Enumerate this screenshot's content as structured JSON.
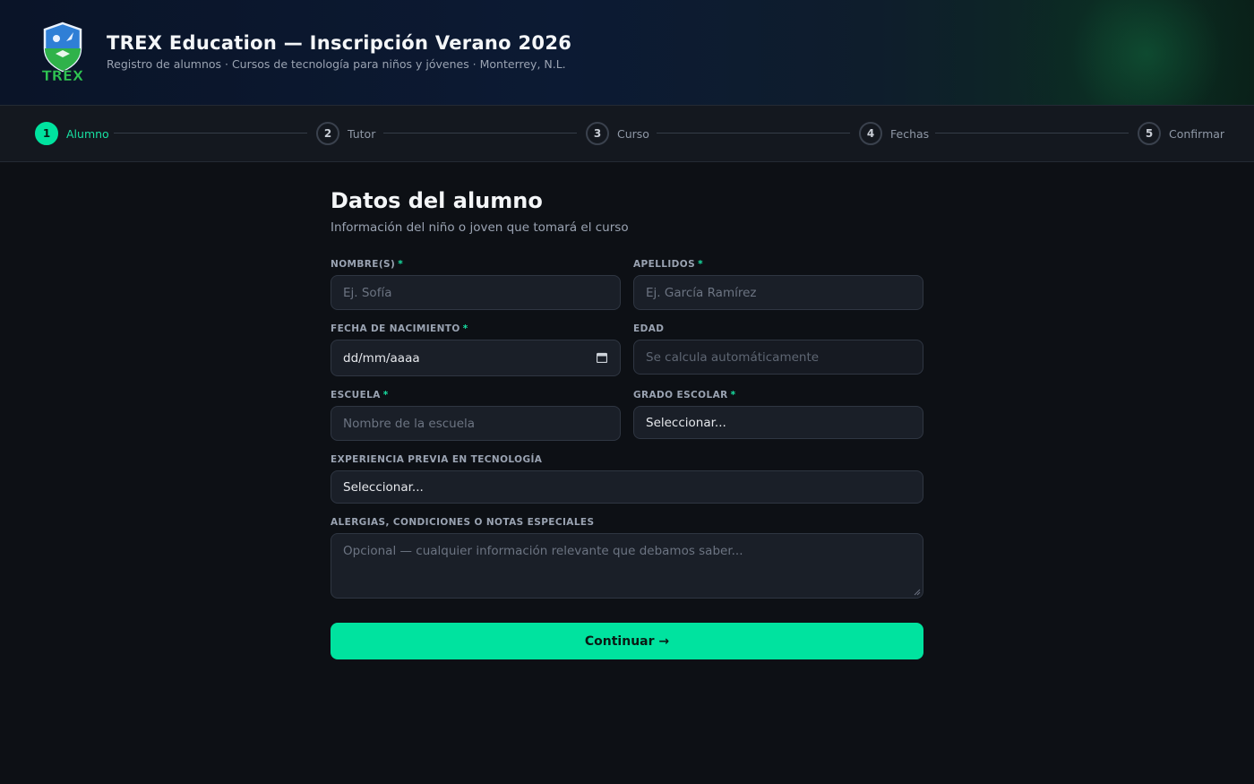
{
  "header": {
    "title": "TREX Education — Inscripción Verano 2026",
    "subtitle": "Registro de alumnos · Cursos de tecnología para niños y jóvenes · Monterrey, N.L.",
    "logo_text": "TREX"
  },
  "stepper": {
    "steps": [
      {
        "number": "1",
        "label": "Alumno",
        "active": true
      },
      {
        "number": "2",
        "label": "Tutor",
        "active": false
      },
      {
        "number": "3",
        "label": "Curso",
        "active": false
      },
      {
        "number": "4",
        "label": "Fechas",
        "active": false
      },
      {
        "number": "5",
        "label": "Confirmar",
        "active": false
      }
    ]
  },
  "form": {
    "title": "Datos del alumno",
    "subtitle": "Información del niño o joven que tomará el curso",
    "required_marker": "*",
    "fields": {
      "nombre": {
        "label": "NOMBRE(S)",
        "placeholder": "Ej. Sofía",
        "required": true
      },
      "apellidos": {
        "label": "APELLIDOS",
        "placeholder": "Ej. García Ramírez",
        "required": true
      },
      "fecha_nacimiento": {
        "label": "FECHA DE NACIMIENTO",
        "value": "dd/mm/aaaa",
        "required": true
      },
      "edad": {
        "label": "EDAD",
        "placeholder": "Se calcula automáticamente",
        "required": false
      },
      "escuela": {
        "label": "ESCUELA",
        "placeholder": "Nombre de la escuela",
        "required": true
      },
      "grado": {
        "label": "GRADO ESCOLAR",
        "value": "Seleccionar...",
        "required": true
      },
      "experiencia": {
        "label": "EXPERIENCIA PREVIA EN TECNOLOGÍA",
        "value": "Seleccionar...",
        "required": false
      },
      "notas": {
        "label": "ALERGIAS, CONDICIONES O NOTAS ESPECIALES",
        "placeholder": "Opcional — cualquier información relevante que debamos saber...",
        "required": false
      }
    },
    "continue_label": "Continuar →"
  },
  "colors": {
    "accent": "#00e39f",
    "background": "#0d1015",
    "field_bg": "#1a1f28"
  }
}
